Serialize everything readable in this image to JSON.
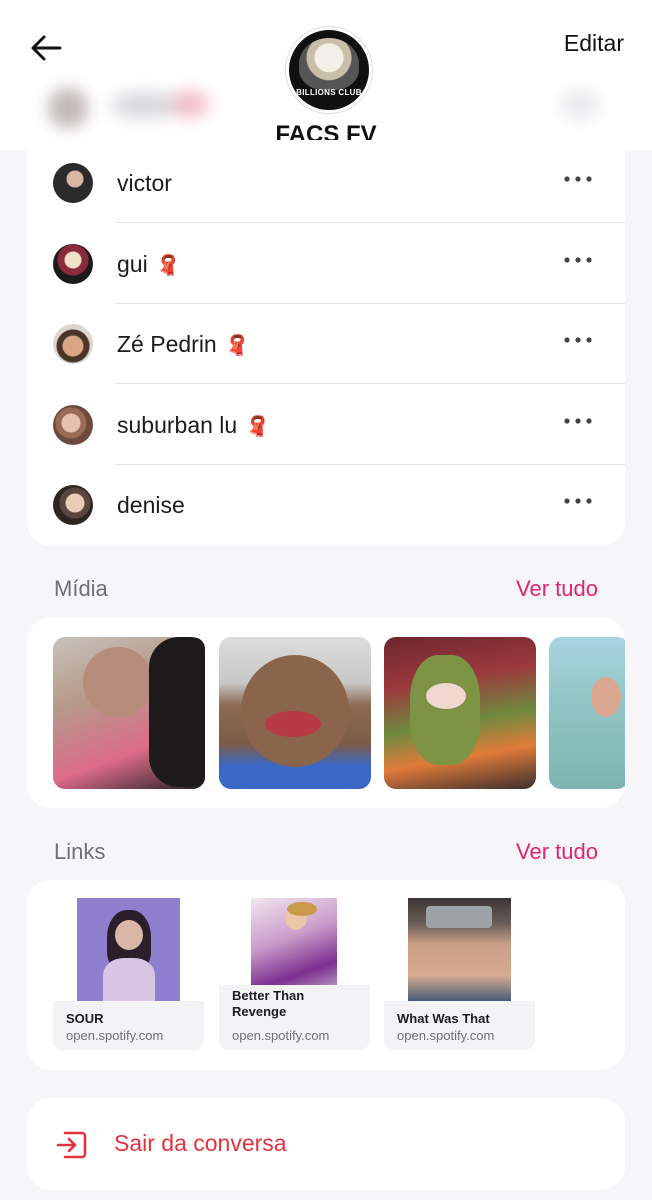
{
  "header": {
    "back_icon": "arrow-left-icon",
    "edit_label": "Editar",
    "avatar_badge": "BILLIONS CLUB",
    "title": "FACS FV"
  },
  "members": [
    {
      "name": "victor",
      "scarf": false,
      "avatar_color": "#2b2b2b"
    },
    {
      "name": "gui",
      "scarf": true,
      "avatar_color": "#8a2a3a"
    },
    {
      "name": "Zé Pedrin",
      "scarf": true,
      "avatar_color": "#6b4f3c"
    },
    {
      "name": "suburban lu",
      "scarf": true,
      "avatar_color": "#9a6b55"
    },
    {
      "name": "denise",
      "scarf": false,
      "avatar_color": "#4a3c36"
    }
  ],
  "scarf_emoji": "🧣",
  "more_icon": "more-horizontal-icon",
  "media": {
    "label": "Mídia",
    "see_all": "Ver tudo"
  },
  "links": {
    "label": "Links",
    "see_all": "Ver tudo",
    "items": [
      {
        "title": "SOUR",
        "domain": "open.spotify.com"
      },
      {
        "title": "Better Than Revenge",
        "domain": "open.spotify.com"
      },
      {
        "title": "What Was That",
        "domain": "open.spotify.com"
      }
    ]
  },
  "leave": {
    "icon": "exit-icon",
    "label": "Sair da conversa"
  },
  "colors": {
    "accent": "#e0246f",
    "danger": "#e2333d",
    "secondary_text": "#6e7076"
  }
}
